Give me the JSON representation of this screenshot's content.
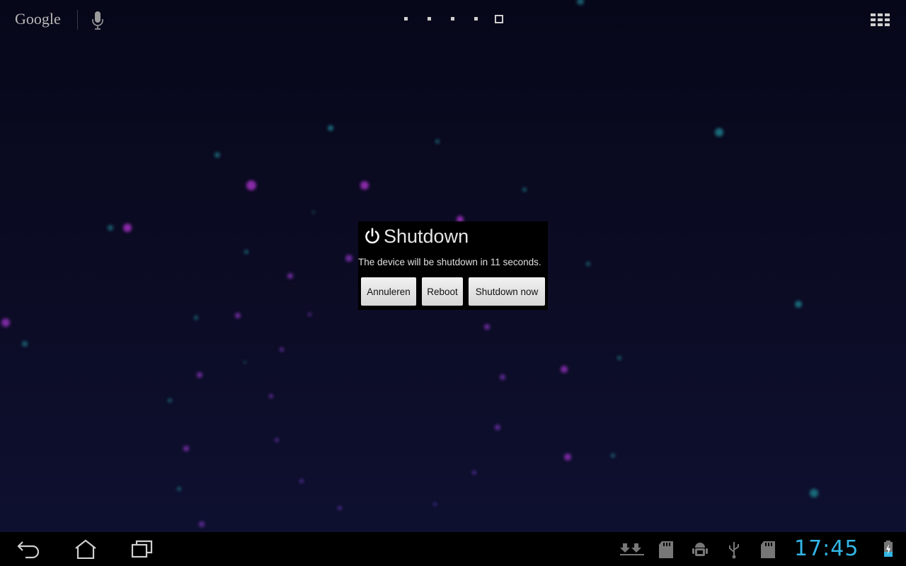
{
  "home_screen": {
    "search_logo": "Google",
    "icons": {
      "mic": "mic-icon",
      "apps": "all-apps-icon"
    },
    "page_indicator": {
      "pages": 5,
      "current_page": 5
    }
  },
  "dialog": {
    "title": "Shutdown",
    "title_icon": "power-icon",
    "message": "The device will be shutdown in 11 seconds.",
    "buttons": {
      "cancel": "Annuleren",
      "reboot": "Reboot",
      "shutdown_now": "Shutdown now"
    }
  },
  "system_bar": {
    "nav_icons": [
      "back-icon",
      "home-icon",
      "recent-apps-icon"
    ],
    "status_icons": [
      "download-icon",
      "sd-card-icon",
      "android-debug-icon",
      "usb-icon",
      "sd-card-icon",
      "battery-charging-icon"
    ],
    "clock": "17:45",
    "accent_color": "#33b5e5"
  }
}
